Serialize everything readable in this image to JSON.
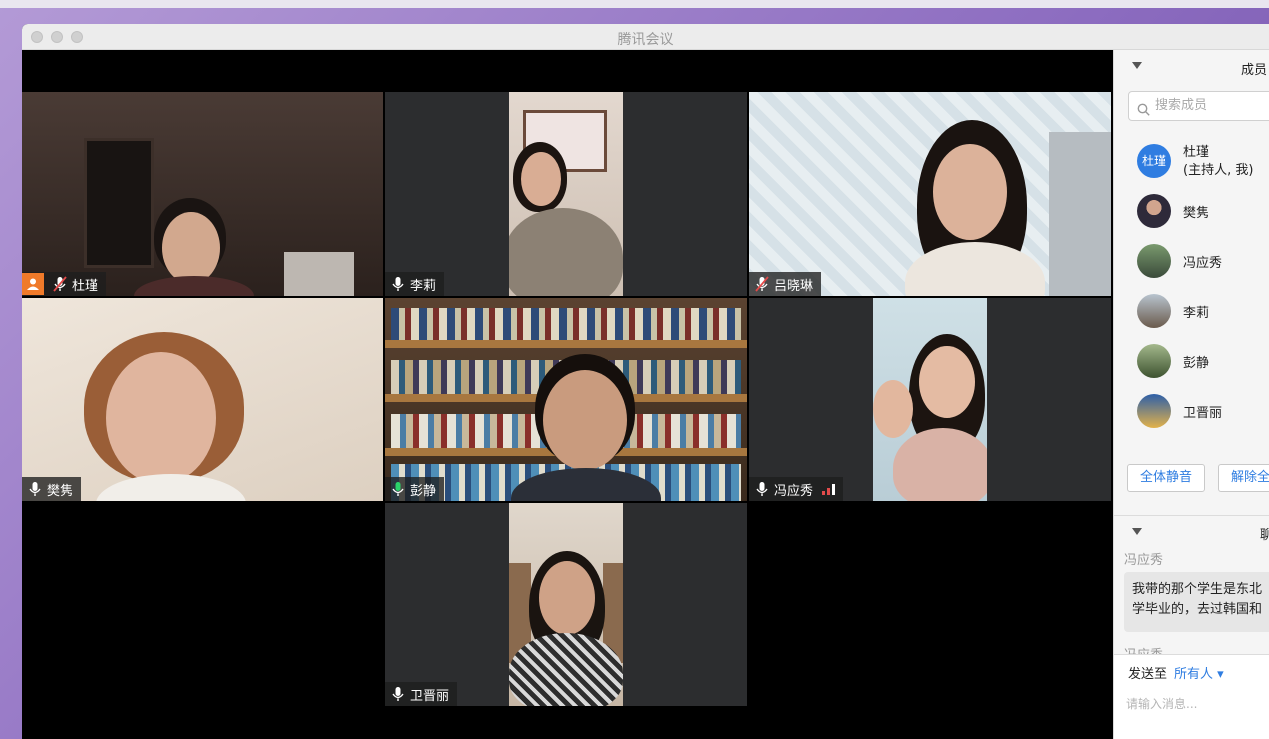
{
  "window": {
    "title": "腾讯会议"
  },
  "participants_grid": [
    {
      "name": "杜瑾",
      "mic": "muted",
      "host_badge": true
    },
    {
      "name": "李莉",
      "mic": "on"
    },
    {
      "name": "吕晓琳",
      "mic": "muted"
    },
    {
      "name": "樊隽",
      "mic": "on"
    },
    {
      "name": "彭静",
      "mic": "on",
      "active_speaker": true
    },
    {
      "name": "冯应秀",
      "mic": "on",
      "signal": "weak"
    },
    {
      "name": "卫晋丽",
      "mic": "on"
    }
  ],
  "sidebar": {
    "members_header": "成员",
    "search_placeholder": "搜索成员",
    "members": [
      {
        "name": "杜瑾",
        "role": "(主持人, 我)",
        "avatar_text": "杜瑾"
      },
      {
        "name": "樊隽"
      },
      {
        "name": "冯应秀"
      },
      {
        "name": "李莉"
      },
      {
        "name": "彭静"
      },
      {
        "name": "卫晋丽"
      }
    ],
    "mute_all_label": "全体静音",
    "unmute_all_label": "解除全",
    "chat_header": "聊",
    "chat": [
      {
        "sender": "冯应秀",
        "lines": [
          "我带的那个学生是东北",
          "学毕业的，去过韩国和"
        ]
      },
      {
        "sender": "冯应秀",
        "lines": [
          ""
        ]
      }
    ],
    "send_to_label": "发送至",
    "send_to_value": "所有人",
    "message_placeholder": "请输入消息..."
  },
  "colors": {
    "active_speaker_border": "#2bd36a",
    "accent_blue": "#2f7de1",
    "host_badge": "#f07a2a"
  }
}
